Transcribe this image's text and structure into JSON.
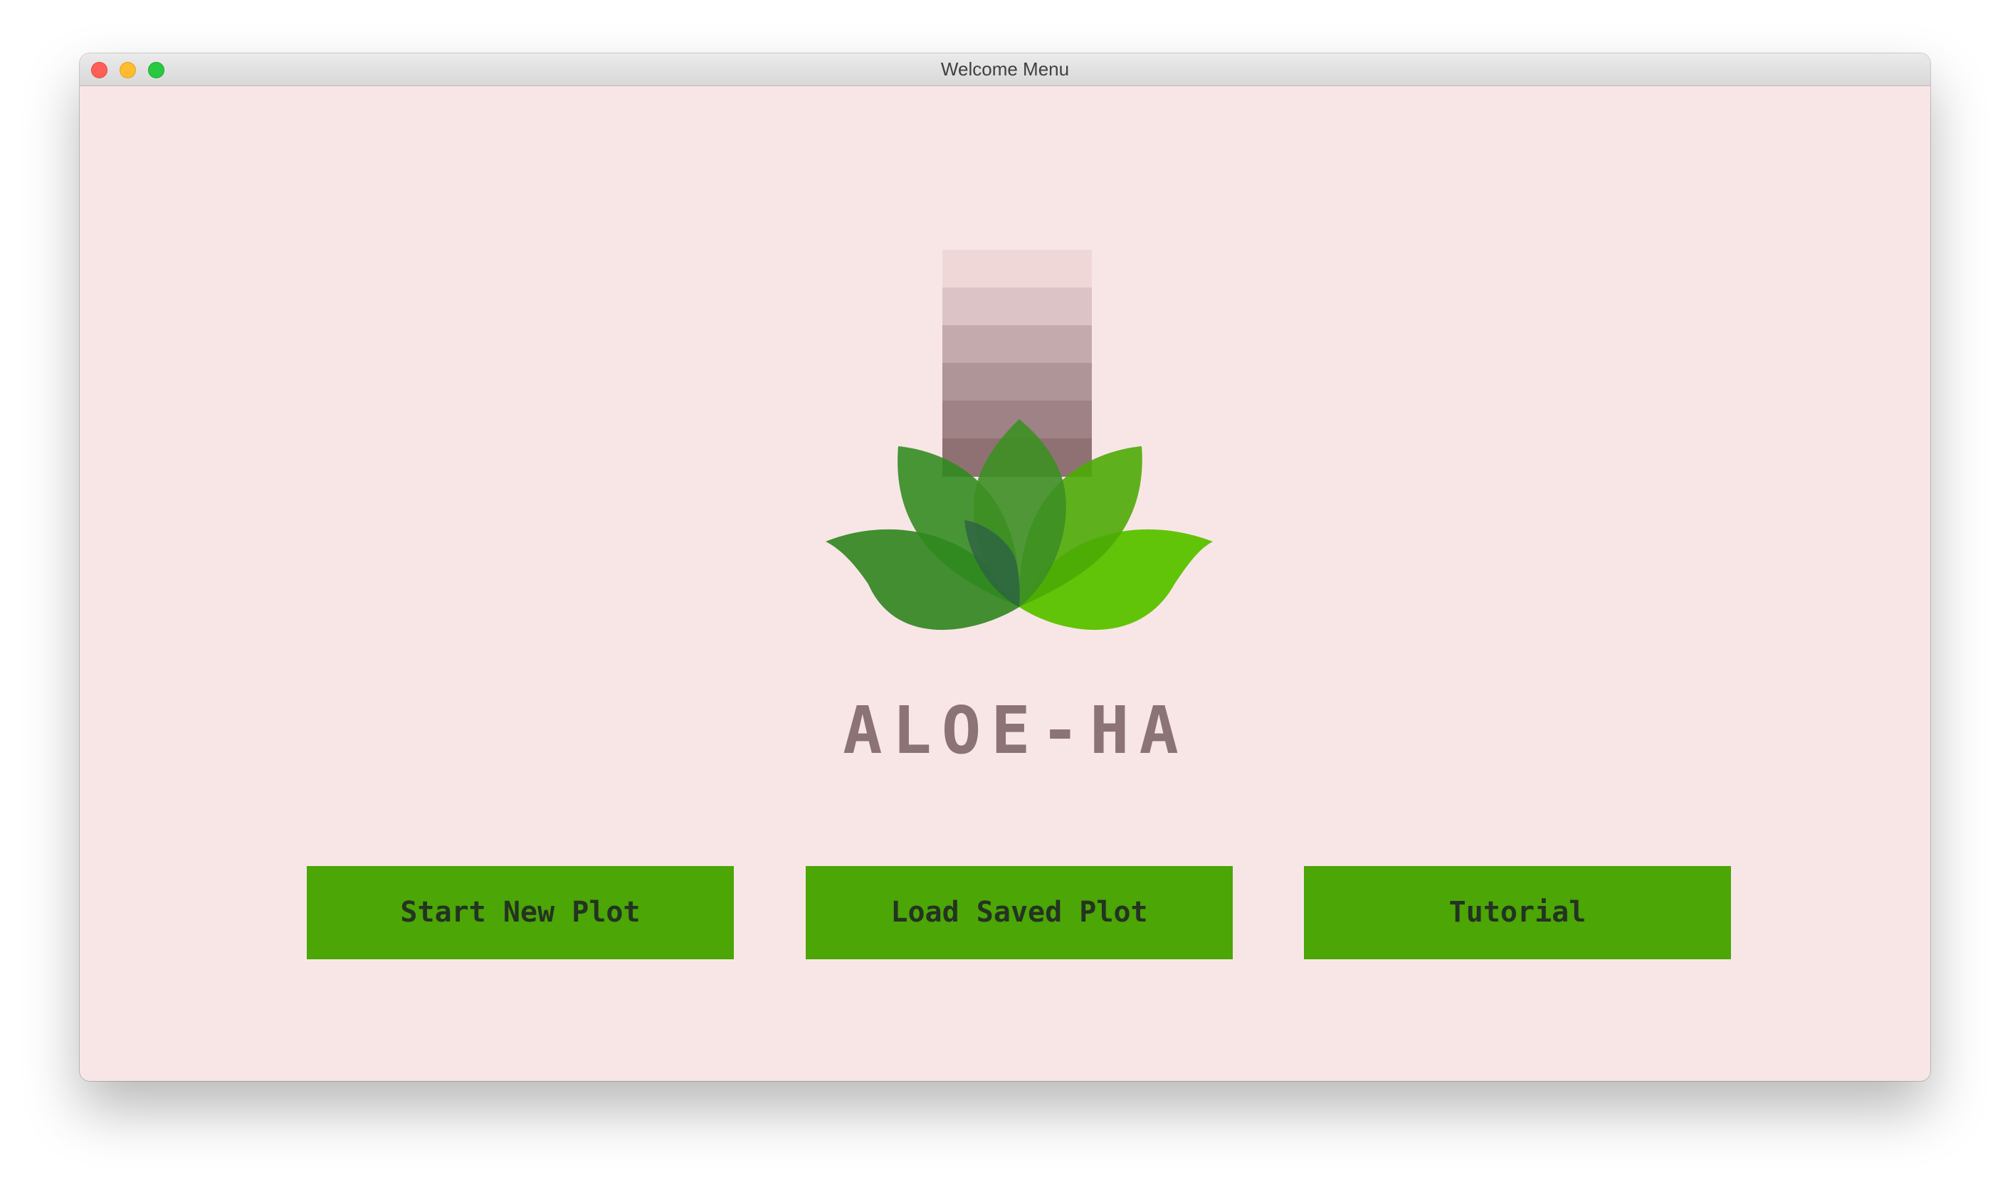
{
  "window": {
    "title": "Welcome Menu"
  },
  "app": {
    "name": "ALOE-HA",
    "logo_icon": "aloe-lotus-leaves-icon"
  },
  "buttons": {
    "start_new_plot": "Start New Plot",
    "load_saved_plot": "Load Saved Plot",
    "tutorial": "Tutorial"
  },
  "colors": {
    "background": "#f8e6e6",
    "button": "#4ba606",
    "button_text": "#243322",
    "app_name": "#8c7375"
  }
}
